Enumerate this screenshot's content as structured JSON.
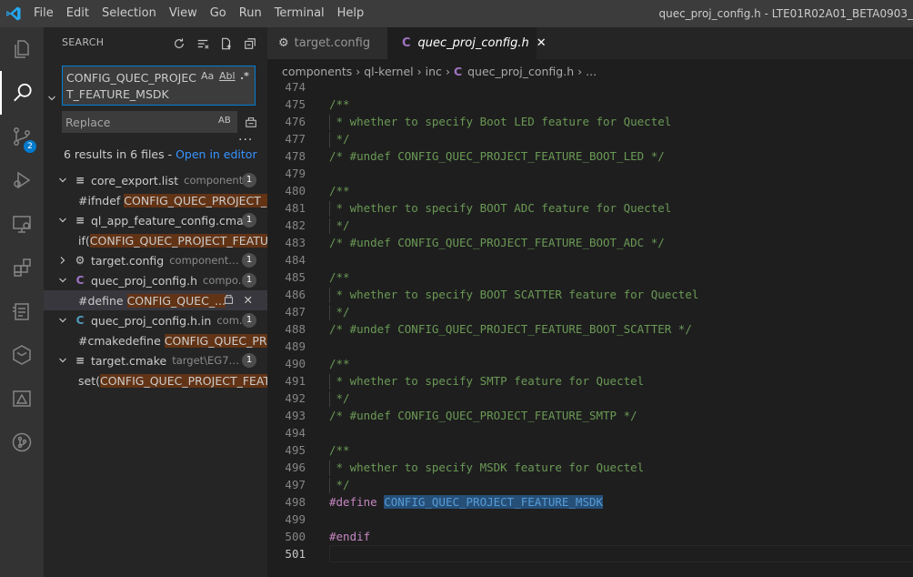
{
  "window": {
    "title": "quec_proj_config.h - LTE01R02A01_BETA0903_"
  },
  "menu": [
    "File",
    "Edit",
    "Selection",
    "View",
    "Go",
    "Run",
    "Terminal",
    "Help"
  ],
  "activity": {
    "source_control_badge": "2"
  },
  "search": {
    "header": "SEARCH",
    "query": "CONFIG_QUEC_PROJECT_FEATURE_MSDK",
    "match_case": "Aa",
    "whole_word": "Abl",
    "regex": ".*",
    "replace_placeholder": "Replace",
    "preserve_case": "AB",
    "summary": "6 results in 6 files - ",
    "open_in_editor": "Open in editor",
    "results": [
      {
        "icon": "≡",
        "icon_color": "#c5c5c5",
        "name": "core_export.list",
        "path": "component...",
        "count": "1",
        "expanded": true,
        "matches": [
          {
            "prefix": "#ifndef ",
            "hit": "CONFIG_QUEC_PROJECT_F...",
            "selected": false
          }
        ]
      },
      {
        "icon": "≡",
        "icon_color": "#c5c5c5",
        "name": "ql_app_feature_config.cma...",
        "path": "",
        "count": "1",
        "expanded": true,
        "matches": [
          {
            "prefix": "if(",
            "hit": "CONFIG_QUEC_PROJECT_FEATU...",
            "selected": false
          }
        ]
      },
      {
        "icon": "⚙",
        "icon_color": "#c5c5c5",
        "name": "target.config",
        "path": "components\\...",
        "count": "1",
        "expanded": false,
        "matches": []
      },
      {
        "icon": "C",
        "icon_color": "#a074c4",
        "name": "quec_proj_config.h",
        "path": "compo...",
        "count": "1",
        "expanded": true,
        "matches": [
          {
            "prefix": "#define ",
            "hit": "CONFIG_QUEC_...",
            "selected": true
          }
        ]
      },
      {
        "icon": "C",
        "icon_color": "#519aba",
        "name": "quec_proj_config.h.in",
        "path": "com...",
        "count": "1",
        "expanded": true,
        "matches": [
          {
            "prefix": "#cmakedefine ",
            "hit": "CONFIG_QUEC_PR...",
            "selected": false
          }
        ]
      },
      {
        "icon": "≡",
        "icon_color": "#c5c5c5",
        "name": "target.cmake",
        "path": "target\\EG700...",
        "count": "1",
        "expanded": true,
        "matches": [
          {
            "prefix": "set(",
            "hit": "CONFIG_QUEC_PROJECT_FEAT...",
            "selected": false
          }
        ]
      }
    ]
  },
  "tabs": [
    {
      "label": "target.config",
      "icon": "⚙",
      "active": false
    },
    {
      "label": "quec_proj_config.h",
      "icon": "C",
      "active": true
    }
  ],
  "breadcrumb": [
    "components",
    "ql-kernel",
    "inc",
    "quec_proj_config.h",
    "..."
  ],
  "code": {
    "lines": [
      {
        "n": "474",
        "parts": []
      },
      {
        "n": "475",
        "parts": [
          {
            "t": "/**",
            "c": "comment"
          }
        ]
      },
      {
        "n": "476",
        "parts": [
          {
            "t": " * whether to specify Boot LED feature for Quectel",
            "c": "comment"
          }
        ]
      },
      {
        "n": "477",
        "parts": [
          {
            "t": " */",
            "c": "comment"
          }
        ]
      },
      {
        "n": "478",
        "parts": [
          {
            "t": "/* #undef CONFIG_QUEC_PROJECT_FEATURE_BOOT_LED */",
            "c": "comment"
          }
        ]
      },
      {
        "n": "479",
        "parts": []
      },
      {
        "n": "480",
        "parts": [
          {
            "t": "/**",
            "c": "comment"
          }
        ]
      },
      {
        "n": "481",
        "parts": [
          {
            "t": " * whether to specify BOOT ADC feature for Quectel",
            "c": "comment"
          }
        ]
      },
      {
        "n": "482",
        "parts": [
          {
            "t": " */",
            "c": "comment"
          }
        ]
      },
      {
        "n": "483",
        "parts": [
          {
            "t": "/* #undef CONFIG_QUEC_PROJECT_FEATURE_BOOT_ADC */",
            "c": "comment"
          }
        ]
      },
      {
        "n": "484",
        "parts": []
      },
      {
        "n": "485",
        "parts": [
          {
            "t": "/**",
            "c": "comment"
          }
        ]
      },
      {
        "n": "486",
        "parts": [
          {
            "t": " * whether to specify BOOT SCATTER feature for Quectel",
            "c": "comment"
          }
        ]
      },
      {
        "n": "487",
        "parts": [
          {
            "t": " */",
            "c": "comment"
          }
        ]
      },
      {
        "n": "488",
        "parts": [
          {
            "t": "/* #undef CONFIG_QUEC_PROJECT_FEATURE_BOOT_SCATTER */",
            "c": "comment"
          }
        ]
      },
      {
        "n": "489",
        "parts": []
      },
      {
        "n": "490",
        "parts": [
          {
            "t": "/**",
            "c": "comment"
          }
        ]
      },
      {
        "n": "491",
        "parts": [
          {
            "t": " * whether to specify SMTP feature for Quectel",
            "c": "comment"
          }
        ]
      },
      {
        "n": "492",
        "parts": [
          {
            "t": " */",
            "c": "comment"
          }
        ]
      },
      {
        "n": "493",
        "parts": [
          {
            "t": "/* #undef CONFIG_QUEC_PROJECT_FEATURE_SMTP */",
            "c": "comment"
          }
        ]
      },
      {
        "n": "494",
        "parts": []
      },
      {
        "n": "495",
        "parts": [
          {
            "t": "/**",
            "c": "comment"
          }
        ]
      },
      {
        "n": "496",
        "parts": [
          {
            "t": " * whether to specify MSDK feature for Quectel",
            "c": "comment"
          }
        ]
      },
      {
        "n": "497",
        "parts": [
          {
            "t": " */",
            "c": "comment"
          }
        ]
      },
      {
        "n": "498",
        "parts": [
          {
            "t": "#define ",
            "c": "kw"
          },
          {
            "t": "CONFIG_QUEC_PROJECT_FEATURE_MSDK",
            "c": "macro hlm"
          }
        ]
      },
      {
        "n": "499",
        "parts": []
      },
      {
        "n": "500",
        "parts": [
          {
            "t": "#endif",
            "c": "kw"
          }
        ]
      },
      {
        "n": "501",
        "parts": [],
        "current": true
      }
    ]
  },
  "colors": {
    "accent": "#007acc",
    "match_highlight": "#623315",
    "selection": "#264f78",
    "comment": "#6a9955",
    "keyword": "#c586c0",
    "macro": "#569cd6"
  }
}
